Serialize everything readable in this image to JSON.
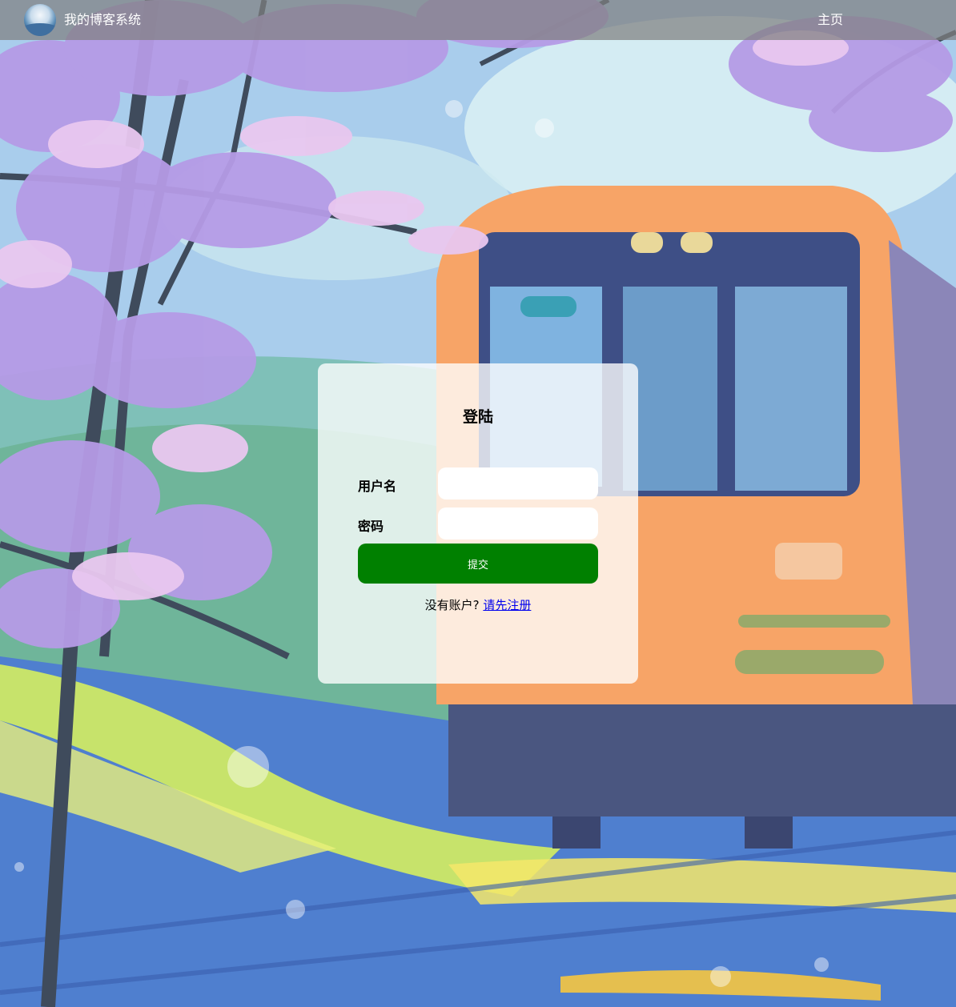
{
  "navbar": {
    "logo_icon": "globe-landscape-logo",
    "site_title": "我的博客系统",
    "home_link": "主页"
  },
  "login": {
    "title": "登陆",
    "username_label": "用户名",
    "username_value": "",
    "password_label": "密码",
    "password_value": "",
    "submit_label": "提交",
    "no_account_text": "没有账户?",
    "register_link": "请先注册"
  },
  "colors": {
    "navbar_bg": "#808080",
    "submit_bg": "#008000",
    "link": "#0000ee",
    "card_bg": "#ffffff"
  }
}
